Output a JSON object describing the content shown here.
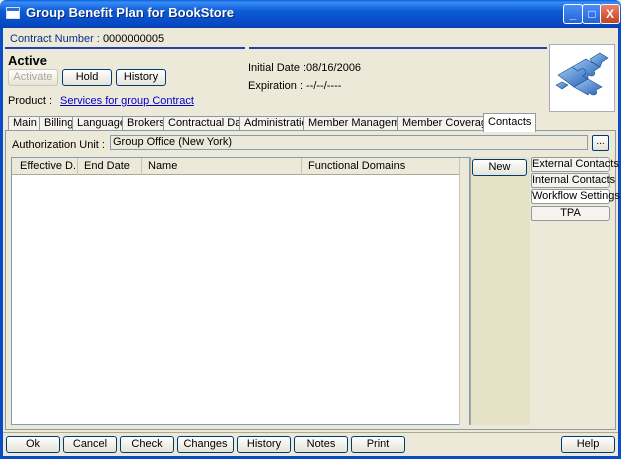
{
  "window": {
    "title": "Group Benefit Plan for BookStore",
    "controls": {
      "minimize": "_",
      "maximize": "□",
      "close": "X"
    }
  },
  "header": {
    "contract_label": "Contract Number :",
    "contract_number": "0000000005",
    "status": "Active",
    "buttons": {
      "activate": "Activate",
      "hold": "Hold",
      "history": "History"
    },
    "product_label": "Product :",
    "product_value": "Services for group Contract",
    "initial_date_label": "Initial Date :",
    "initial_date_value": "08/16/2006",
    "expiration_label": "Expiration :",
    "expiration_value": "--/--/----"
  },
  "tabs": [
    {
      "label": "Main"
    },
    {
      "label": "Billing"
    },
    {
      "label": "Language"
    },
    {
      "label": "Brokers"
    },
    {
      "label": "Contractual Data"
    },
    {
      "label": "Administration"
    },
    {
      "label": "Member Management"
    },
    {
      "label": "Member Coverages"
    },
    {
      "label": "Contacts"
    }
  ],
  "active_tab": "Contacts",
  "contacts": {
    "auth_label": "Authorization Unit :",
    "auth_value": "Group Office (New York)",
    "browse_label": "...",
    "columns": [
      "Effective D...",
      "End Date",
      "Name",
      "Functional Domains"
    ],
    "new_button": "New",
    "side_tabs": [
      "External Contacts",
      "Internal Contacts",
      "Workflow Settings",
      "TPA"
    ],
    "active_side_tab": "Workflow Settings"
  },
  "footer": {
    "buttons": [
      "Ok",
      "Cancel",
      "Check",
      "Changes",
      "History",
      "Notes",
      "Print"
    ],
    "help": "Help"
  },
  "colors": {
    "titlebar": "#0A5FD8",
    "link": "#0000CC",
    "contract_label": "#0A2F8C",
    "face": "#ECE9D8"
  }
}
